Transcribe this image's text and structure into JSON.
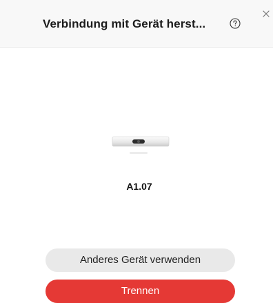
{
  "dialog": {
    "title": "Verbindung mit Gerät herst...",
    "help_icon": "help-circle-icon",
    "close_icon": "close-icon"
  },
  "device": {
    "image_icon": "webex-room-bar-device-icon",
    "name": "A1.07"
  },
  "actions": {
    "other_device_label": "Anderes Gerät verwenden",
    "disconnect_label": "Trennen"
  },
  "colors": {
    "header_background": "#f8f8f8",
    "secondary_button": "#e9e9e9",
    "danger_button": "#e53935"
  }
}
